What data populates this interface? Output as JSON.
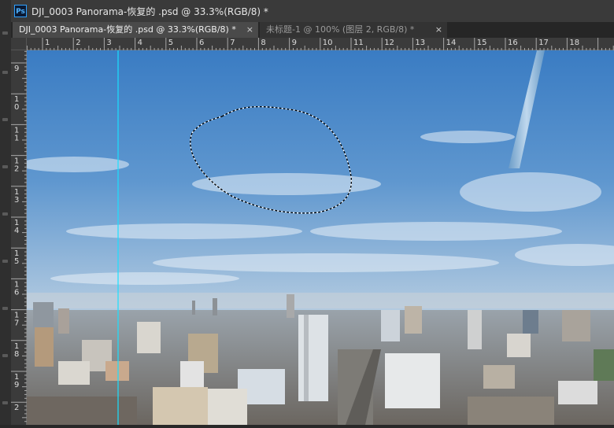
{
  "window": {
    "app_icon": "Ps",
    "title": "DJI_0003  Panorama-恢复的 .psd @ 33.3%(RGB/8) *"
  },
  "tabs": [
    {
      "label": "DJI_0003  Panorama-恢复的 .psd @ 33.3%(RGB/8) *",
      "active": true,
      "close": "×"
    },
    {
      "label": "未标题-1 @ 100% (图层 2, RGB/8) *",
      "active": false,
      "close": "×"
    }
  ],
  "rulers": {
    "horizontal_labels": [
      "1",
      "2",
      "3",
      "4",
      "5",
      "6",
      "7",
      "8",
      "9",
      "10",
      "11",
      "12",
      "13",
      "14",
      "15",
      "16",
      "17",
      "18"
    ],
    "vertical_labels": [
      "9",
      "10",
      "11",
      "12",
      "13",
      "14",
      "15",
      "16",
      "17",
      "18",
      "19",
      "2"
    ]
  },
  "colors": {
    "sky_top": "#3d7fc4",
    "sky_bottom": "#c7d8e8",
    "guide": "#19e0ff",
    "ruler_bg": "#3b3b3b",
    "app_bg": "#282828"
  },
  "icons": [
    "photoshop-icon",
    "close-icon",
    "marquee-selection"
  ]
}
